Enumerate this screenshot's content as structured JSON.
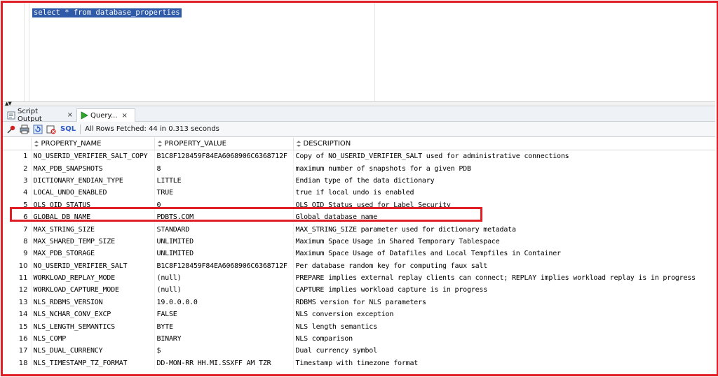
{
  "editor": {
    "sql": "select * from database_properties"
  },
  "tabs": [
    {
      "label": "Script Output",
      "close": "×"
    },
    {
      "label": "Query...",
      "close": "×"
    }
  ],
  "toolbar": {
    "sql_label": "SQL",
    "status": "All Rows Fetched: 44 in 0.313 seconds",
    "icons": [
      "pin-icon",
      "print-icon",
      "refresh-icon",
      "cancel-query-icon"
    ]
  },
  "grid": {
    "columns": [
      "PROPERTY_NAME",
      "PROPERTY_VALUE",
      "DESCRIPTION"
    ],
    "rows": [
      {
        "n": "1",
        "name": "NO_USERID_VERIFIER_SALT_COPY",
        "value": "B1C8F128459F84EA6068906C6368712F",
        "desc": "Copy of NO_USERID_VERIFIER_SALT used for administrative connections"
      },
      {
        "n": "2",
        "name": "MAX_PDB_SNAPSHOTS",
        "value": "8",
        "desc": "maximum number of snapshots for a given PDB"
      },
      {
        "n": "3",
        "name": "DICTIONARY_ENDIAN_TYPE",
        "value": "LITTLE",
        "desc": "Endian type of the data dictionary"
      },
      {
        "n": "4",
        "name": "LOCAL_UNDO_ENABLED",
        "value": "TRUE",
        "desc": "true if local undo is enabled"
      },
      {
        "n": "5",
        "name": "OLS_OID_STATUS",
        "value": "0",
        "desc": "OLS OID Status used for Label Security"
      },
      {
        "n": "6",
        "name": "GLOBAL_DB_NAME",
        "value": "PDBTS.COM",
        "desc": "Global database name"
      },
      {
        "n": "7",
        "name": "MAX_STRING_SIZE",
        "value": "STANDARD",
        "desc": "MAX_STRING_SIZE parameter used for dictionary metadata"
      },
      {
        "n": "8",
        "name": "MAX_SHARED_TEMP_SIZE",
        "value": "UNLIMITED",
        "desc": "Maximum Space Usage in Shared Temporary Tablespace"
      },
      {
        "n": "9",
        "name": "MAX_PDB_STORAGE",
        "value": "UNLIMITED",
        "desc": "Maximum Space Usage of Datafiles and Local Tempfiles in Container"
      },
      {
        "n": "10",
        "name": "NO_USERID_VERIFIER_SALT",
        "value": "B1C8F128459F84EA6068906C6368712F",
        "desc": "Per database random key for computing faux salt"
      },
      {
        "n": "11",
        "name": "WORKLOAD_REPLAY_MODE",
        "value": "(null)",
        "desc": "PREPARE implies external replay clients can connect; REPLAY implies workload replay is in progress"
      },
      {
        "n": "12",
        "name": "WORKLOAD_CAPTURE_MODE",
        "value": "(null)",
        "desc": "CAPTURE implies workload capture is in progress"
      },
      {
        "n": "13",
        "name": "NLS_RDBMS_VERSION",
        "value": "19.0.0.0.0",
        "desc": "RDBMS version for NLS parameters"
      },
      {
        "n": "14",
        "name": "NLS_NCHAR_CONV_EXCP",
        "value": "FALSE",
        "desc": "NLS conversion exception"
      },
      {
        "n": "15",
        "name": "NLS_LENGTH_SEMANTICS",
        "value": "BYTE",
        "desc": "NLS length semantics"
      },
      {
        "n": "16",
        "name": "NLS_COMP",
        "value": "BINARY",
        "desc": "NLS comparison"
      },
      {
        "n": "17",
        "name": "NLS_DUAL_CURRENCY",
        "value": "$",
        "desc": "Dual currency symbol"
      },
      {
        "n": "18",
        "name": "NLS_TIMESTAMP_TZ_FORMAT",
        "value": "DD-MON-RR HH.MI.SSXFF AM TZR",
        "desc": "Timestamp with timezone format"
      }
    ]
  },
  "highlight": {
    "row": "6",
    "color": "#e01e25"
  }
}
